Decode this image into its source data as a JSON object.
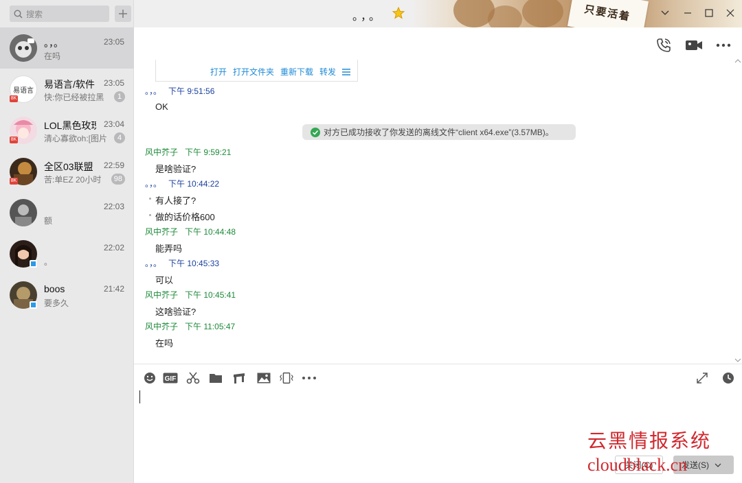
{
  "search": {
    "placeholder": "搜索"
  },
  "contacts": [
    {
      "name": "。，。",
      "time": "23:05",
      "preview": "在吗",
      "unread": "",
      "badge": ""
    },
    {
      "name": "易语言/软件",
      "time": "23:05",
      "preview": "快:你已经被拉黑",
      "unread": "1",
      "badge": "8K",
      "avatar_text": "易语言"
    },
    {
      "name": "LOL黑色玫瑰",
      "time": "23:04",
      "preview": "清心寡欲oh:[图片]",
      "unread": "4",
      "badge": "8K"
    },
    {
      "name": "全区03联盟",
      "time": "22:59",
      "preview": "苦:单EZ  20小时",
      "unread": "98",
      "badge": "8K"
    },
    {
      "name": "",
      "time": "22:03",
      "preview": "额",
      "unread": "",
      "badge": ""
    },
    {
      "name": "",
      "time": "22:02",
      "preview": "。",
      "unread": "",
      "badge": ""
    },
    {
      "name": "boos",
      "time": "21:42",
      "preview": "要多久",
      "unread": "",
      "badge": ""
    }
  ],
  "chat": {
    "title": "。，。",
    "banner_text": "只要活着"
  },
  "file_card": {
    "actions": [
      "打开",
      "打开文件夹",
      "重新下载",
      "转发"
    ]
  },
  "messages": [
    {
      "sender": "。，。",
      "time": "下午 9:51:56",
      "lines": [
        "OK"
      ],
      "who": "them"
    },
    {
      "sender": "风中芥子",
      "time": "下午 9:59:21",
      "lines": [
        "是啥验证?"
      ],
      "who": "me"
    },
    {
      "sender": "。，。",
      "time": "下午 10:44:22",
      "lines": [
        "有人接了?",
        "做的话价格600"
      ],
      "who": "them"
    },
    {
      "sender": "风中芥子",
      "time": "下午 10:44:48",
      "lines": [
        "能弄吗"
      ],
      "who": "me"
    },
    {
      "sender": "。，。",
      "time": "下午 10:45:33",
      "lines": [
        "可以"
      ],
      "who": "them"
    },
    {
      "sender": "风中芥子",
      "time": "下午 10:45:41",
      "lines": [
        "这啥验证?"
      ],
      "who": "me"
    },
    {
      "sender": "风中芥子",
      "time": "下午 11:05:47",
      "lines": [
        "在吗"
      ],
      "who": "me"
    }
  ],
  "system_notice": "对方已成功接收了你发送的离线文件“client x64.exe”(3.57MB)。",
  "composer": {
    "close_label": "关闭(C)",
    "send_label": "发送(S)"
  },
  "watermark": {
    "title": "云黑情报系统",
    "url": "cloudblack.cn"
  },
  "colors": {
    "them_header": "#1a3f9e",
    "me_header": "#1d8a39",
    "link": "#1d8ad6",
    "watermark": "#d0282e"
  }
}
